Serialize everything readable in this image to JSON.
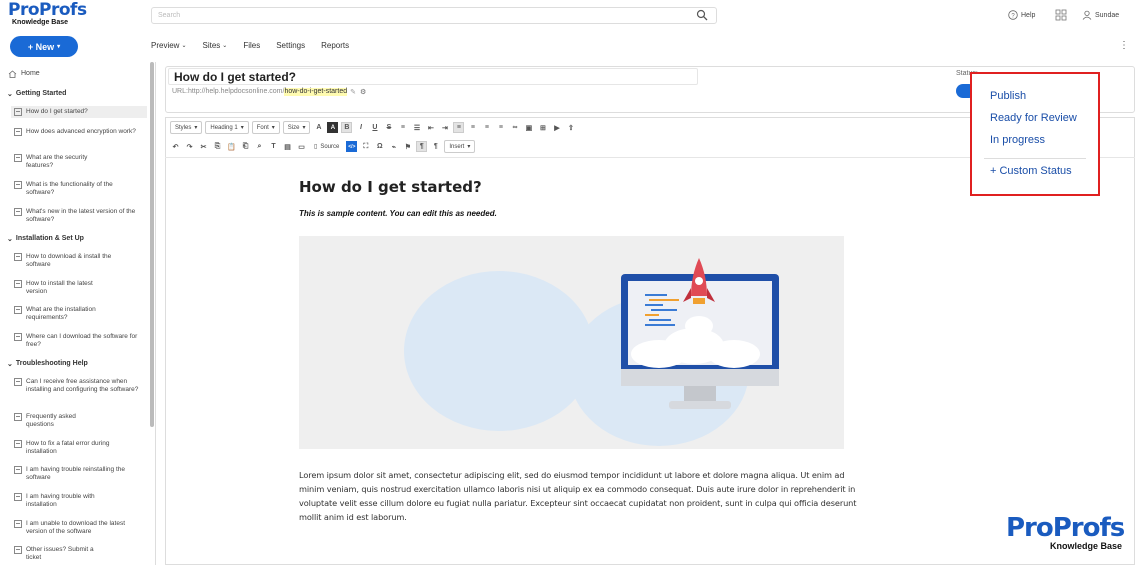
{
  "header": {
    "logo_line1": "ProProfs",
    "logo_line2": "Knowledge Base",
    "search_placeholder": "Search",
    "help_label": "Help",
    "user_label": "Sundae"
  },
  "new_button": "+ New",
  "nav": [
    "Preview",
    "Sites",
    "Files",
    "Settings",
    "Reports"
  ],
  "sidebar": {
    "home": "Home",
    "sections": [
      {
        "title": "Getting Started",
        "items": [
          "How do I get started?",
          "How does advanced encryption work?",
          "What are the security features?",
          "What is the functionality of the software?",
          "What's new in the latest version of the software?"
        ]
      },
      {
        "title": "Installation & Set Up",
        "items": [
          "How to download & install the software",
          "How to install the latest version",
          "What are the installation requirements?",
          "Where can I download the software for free?"
        ]
      },
      {
        "title": "Troubleshooting Help",
        "items": [
          "Can I receive free assistance when installing and configuring the software?",
          "Frequently asked questions",
          "How to fix a fatal error during installation",
          "I am having trouble reinstalling the software",
          "I am having trouble with installation",
          "I am unable to download the latest version of the software",
          "Other issues? Submit a ticket"
        ]
      }
    ]
  },
  "article": {
    "title": "How do I get started?",
    "url_prefix": "URL:http://help.helpdocsonline.com/",
    "url_slug": "how-do-i-get-started",
    "status_label": "Status:"
  },
  "toolbar": {
    "styles": "Styles",
    "format": "Heading 1",
    "font": "Font",
    "size": "Size",
    "source": "Source",
    "insert": "Insert"
  },
  "document": {
    "heading": "How do I get started?",
    "subheading": "This is sample content. You can edit this as needed.",
    "body": "Lorem ipsum dolor sit amet, consectetur adipiscing elit, sed do eiusmod tempor incididunt ut labore et dolore magna aliqua. Ut enim ad minim veniam, quis nostrud exercitation ullamco laboris nisi ut aliquip ex ea commodo consequat. Duis aute irure dolor in reprehenderit in voluptate velit esse cillum dolore eu fugiat nulla pariatur. Excepteur sint occaecat cupidatat non proident, sunt in culpa qui officia deserunt mollit anim id est laborum."
  },
  "status_dropdown": {
    "options": [
      "Publish",
      "Ready for Review",
      "In progress"
    ],
    "custom": "+ Custom Status"
  },
  "brand": {
    "line1": "ProProfs",
    "line2": "Knowledge Base"
  },
  "colors": {
    "accent": "#1a6ad6",
    "highlight_border": "#e02020",
    "option_text": "#1a4ea8"
  }
}
